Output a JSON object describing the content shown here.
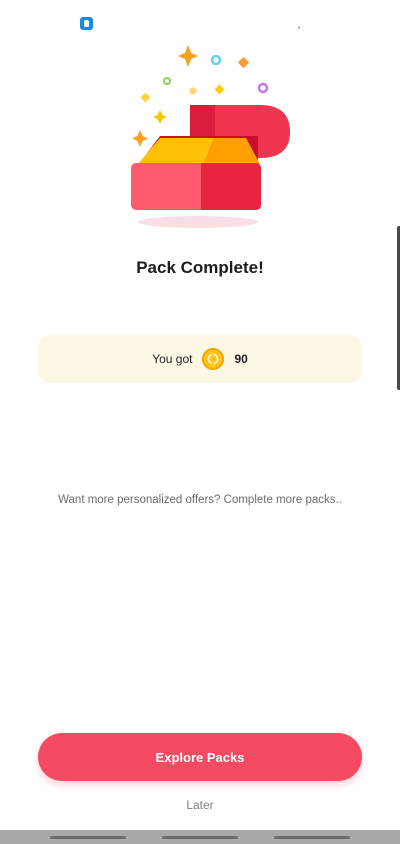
{
  "status_bar": {
    "app_icon": "rocket-app-icon",
    "tick": "ˏ"
  },
  "pack": {
    "title": "Pack Complete!",
    "illustration": "gift-box-open-illustration"
  },
  "reward": {
    "label": "You got",
    "icon": "coin-icon",
    "value": "90"
  },
  "offers_message": "Want more personalized offers? Complete more packs..",
  "actions": {
    "primary_label": "Explore Packs",
    "secondary_label": "Later"
  },
  "colors": {
    "primary": "#f44a62",
    "reward_bg": "#fdf8e6",
    "coin": "#ffc21a"
  }
}
